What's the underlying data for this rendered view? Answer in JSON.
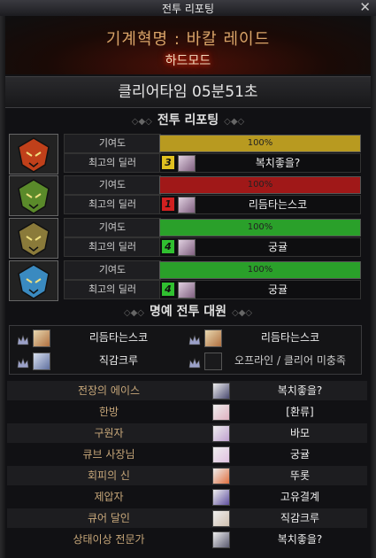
{
  "window": {
    "title": "전투 리포팅",
    "close_label": "✕"
  },
  "dungeon": {
    "name": "기계혁명 : 바칼 레이드",
    "difficulty": "하드모드"
  },
  "clear_time": "클리어타임   05분51초",
  "sections": {
    "battle_report": "전투 리포팅",
    "honor_party": "명예 전투 대원"
  },
  "labels": {
    "contribution": "기여도",
    "best_dealer": "최고의 딜러"
  },
  "parties": [
    {
      "contribution_text": "100%",
      "contribution": 1.0,
      "bar_color": "#b89a20",
      "rank": "3",
      "rank_color": "#e0c020",
      "dealer": "복치좋을?",
      "portrait_color": "#c0401a"
    },
    {
      "contribution_text": "100%",
      "contribution": 1.0,
      "bar_color": "#a01818",
      "rank": "1",
      "rank_color": "#d02020",
      "dealer": "리듬타는스코",
      "portrait_color": "#5a8a2a"
    },
    {
      "contribution_text": "100%",
      "contribution": 1.0,
      "bar_color": "#2aa02a",
      "rank": "4",
      "rank_color": "#30c030",
      "dealer": "궁귤",
      "portrait_color": "#8a7a3a"
    },
    {
      "contribution_text": "100%",
      "contribution": 1.0,
      "bar_color": "#2aa02a",
      "rank": "4",
      "rank_color": "#30c030",
      "dealer": "궁귤",
      "portrait_color": "#3a8ac0"
    }
  ],
  "honor": [
    {
      "name": "리듬타는스코"
    },
    {
      "name": "리듬타는스코"
    },
    {
      "name": "직감크루"
    },
    {
      "name": "오프라인 / 클리어 미충족"
    }
  ],
  "awards": [
    {
      "title": "전장의 에이스",
      "player": "복치좋을?"
    },
    {
      "title": "한방",
      "player": "[환류]"
    },
    {
      "title": "구원자",
      "player": "바모"
    },
    {
      "title": "큐브 사장님",
      "player": "궁귤"
    },
    {
      "title": "회피의 신",
      "player": "뚜롯"
    },
    {
      "title": "제압자",
      "player": "고유결계"
    },
    {
      "title": "큐어 달인",
      "player": "직감크루"
    },
    {
      "title": "상태이상 전문가",
      "player": "복치좋을?"
    }
  ]
}
